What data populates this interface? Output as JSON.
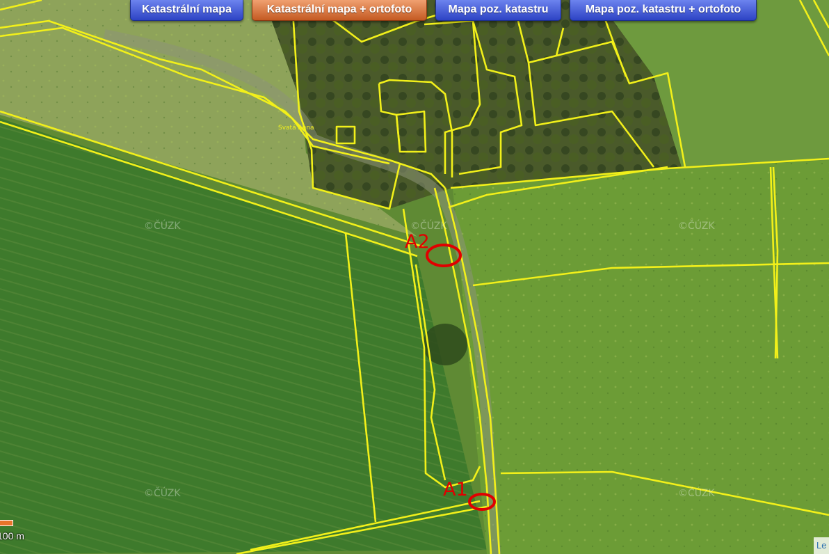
{
  "toolbar": {
    "buttons": [
      {
        "label": "Katastrální mapa",
        "active": false
      },
      {
        "label": "Katastrální mapa + ortofoto",
        "active": true
      },
      {
        "label": "Mapa poz. katastru",
        "active": false
      },
      {
        "label": "Mapa poz. katastru + ortofoto",
        "active": false
      }
    ]
  },
  "map": {
    "watermarks": [
      "©ČÚZK",
      "©ČÚZK",
      "©ČÚZK",
      "©ČÚZK",
      "©ČÚZK"
    ],
    "place_label": "Svatá Anna",
    "markers": [
      {
        "label": "A2"
      },
      {
        "label": "A1"
      }
    ],
    "parcel_line_color": "#f2f01a",
    "marker_color": "#e00000"
  },
  "scale": {
    "label": "100 m"
  },
  "attribution": {
    "label": "Le"
  }
}
